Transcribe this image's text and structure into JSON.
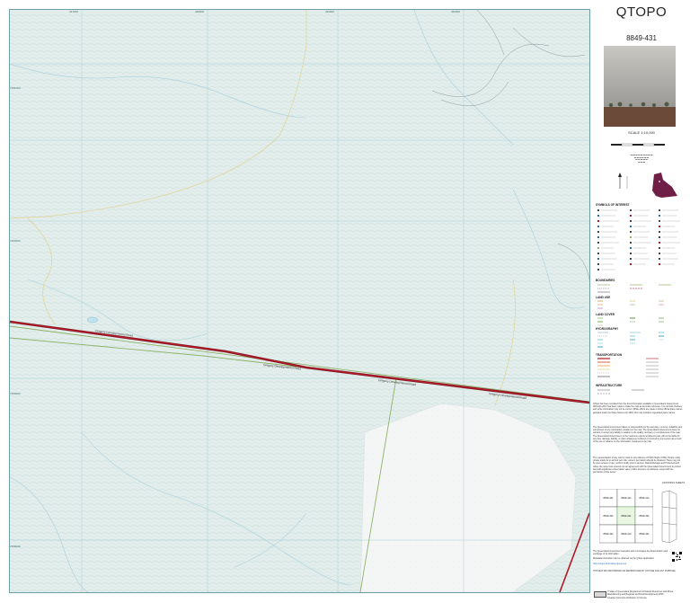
{
  "map": {
    "title": "QTOPO",
    "sheet_number": "8849-431",
    "scale": "SCALE 1:10,000",
    "scale_ticks": [
      "0",
      "100",
      "200",
      "300",
      "400",
      "500"
    ],
    "scale_unit": "m",
    "road_labels": [
      "Gregory Developmental Road",
      "Gregory Developmental Road",
      "Gregory Developmental Road",
      "Gregory Developmental Road"
    ],
    "grid_top": [
      "447000",
      "448000",
      "449000",
      "450000",
      "451000"
    ],
    "grid_left": [
      "7461000",
      "7460000",
      "7459000",
      "7458000",
      "7457000"
    ],
    "colors": {
      "road_red": "#b21826",
      "road_casing": "#6f1b22",
      "boundary_green": "#8fb26a",
      "track_yellow": "#e7dca2",
      "water_blue": "#c9e6ef",
      "grid_blue": "#79b6c9",
      "state_map_maroon": "#6f1e45"
    }
  },
  "legend": {
    "heading": "SYMBOLS OF INTEREST",
    "sections": [
      "BOUNDARIES",
      "LAND USE",
      "LAND COVER",
      "HYDROGRAPHY",
      "TRANSPORTATION",
      "INFRASTRUCTURE"
    ]
  },
  "notes": {
    "disclaimer1": "QTopo has been compiled from the best information available to Queensland Government. Although effort has been made to make the map as accurate reference, it is not field checked, and some information may not be current. While efforts are made to show official place names gazetted under the Place Names Act 1994, this map contains unguarded place names.",
    "disclaimer2": "The Queensland Government takes no responsibility for the accuracy, currency, reliability, and correctness of any information included on the map. The Queensland Government does not warrant or accept any liability in relation to the quality, accuracy or completeness of the map. The Queensland Government, to the maximum extent permitted by law, will not be liable for any loss, damage, liability, or claim whatsoever suffered or incurred by any person as a result of the use or reliance on the information contained in the map.",
    "disclaimer3": "The representation of any road or track is not evidence of Public Right of Way. People using private roads do so at their own risk, owners' permission should be obtained. There may not be open access of use; confirm locally prior to access. Natural Refuges and Protected land where the owner has entered into an agreement with the Queensland Government to protect land with significant conservation value, public access is not allowed, except with the permission of the owner.",
    "feedback": "The Queensland Government supports and encourages the dissemination and exchange of its information.",
    "qr_text": "Metadata information can be obtained via the QTopo application:",
    "url": "https://qtopo.information.qld.gov.au",
    "print_note": "THIS MAP MAY BE PRINTED OR REPRODUCED BY ANYONE FOR ANY PURPOSE.",
    "copyright": "© State of Queensland (Department of Natural Resources and Mines, Manufacturing and Regional and Rural Development) 2025",
    "license": "Creative Commons Attribution 4.0 licence"
  },
  "index": {
    "title": "ADJOINING SHEETS",
    "cells": [
      "8849-441",
      "8849-442",
      "8849-412",
      "8849-433",
      "8849-431",
      "8849-434",
      "8849-432",
      "8849-412",
      "8849-434"
    ]
  }
}
